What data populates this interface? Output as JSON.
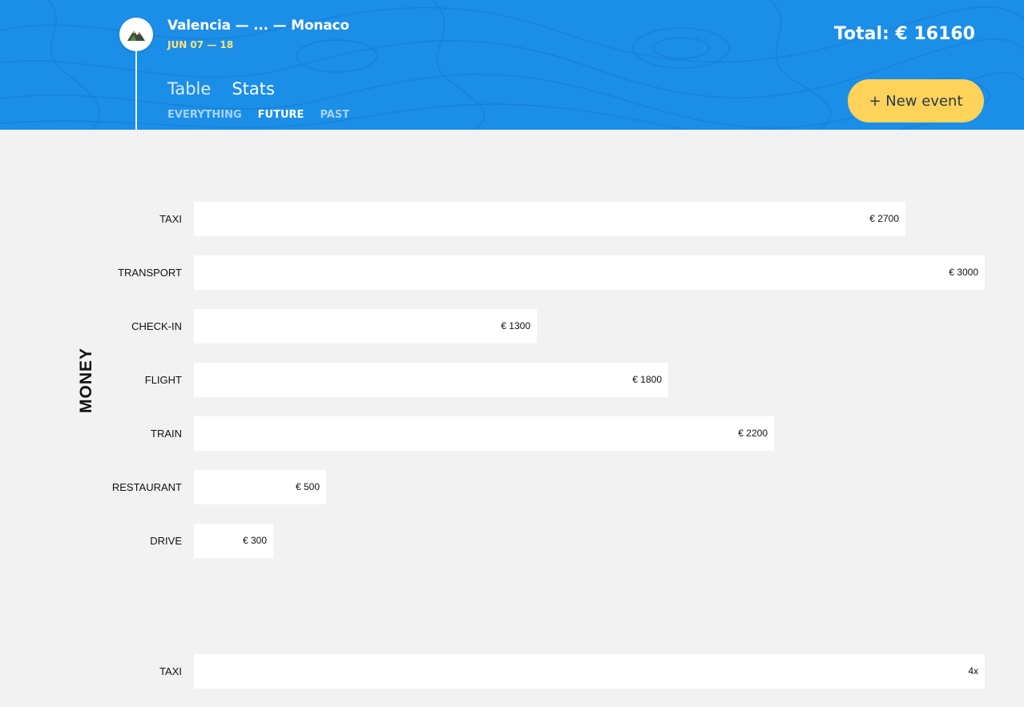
{
  "header": {
    "trip_title": "Valencia — ... — Monaco",
    "trip_dates": "JUN 07 — 18",
    "total": "Total: € 16160",
    "views": [
      "Table",
      "Stats"
    ],
    "filters": [
      "EVERYTHING",
      "FUTURE",
      "PAST"
    ],
    "active_filter": "FUTURE",
    "new_event_label": "+ New event",
    "colors": {
      "header_bg": "#1b8ee8",
      "accent_yellow": "#ffd25a",
      "dates_yellow": "#ffe27a"
    }
  },
  "chart_data": [
    {
      "type": "bar",
      "orientation": "horizontal",
      "title": "MONEY",
      "categories": [
        "TAXI",
        "TRANSPORT",
        "CHECK-IN",
        "FLIGHT",
        "TRAIN",
        "RESTAURANT",
        "DRIVE"
      ],
      "values": [
        2700,
        3000,
        1300,
        1800,
        2200,
        500,
        300
      ],
      "value_labels": [
        "€ 2700",
        "€ 3000",
        "€ 1300",
        "€ 1800",
        "€ 2200",
        "€ 500",
        "€ 300"
      ],
      "xlim": [
        0,
        3000
      ]
    },
    {
      "type": "bar",
      "orientation": "horizontal",
      "categories": [
        "TAXI"
      ],
      "values": [
        4
      ],
      "value_labels": [
        "4x"
      ],
      "xlim": [
        0,
        4
      ]
    }
  ]
}
